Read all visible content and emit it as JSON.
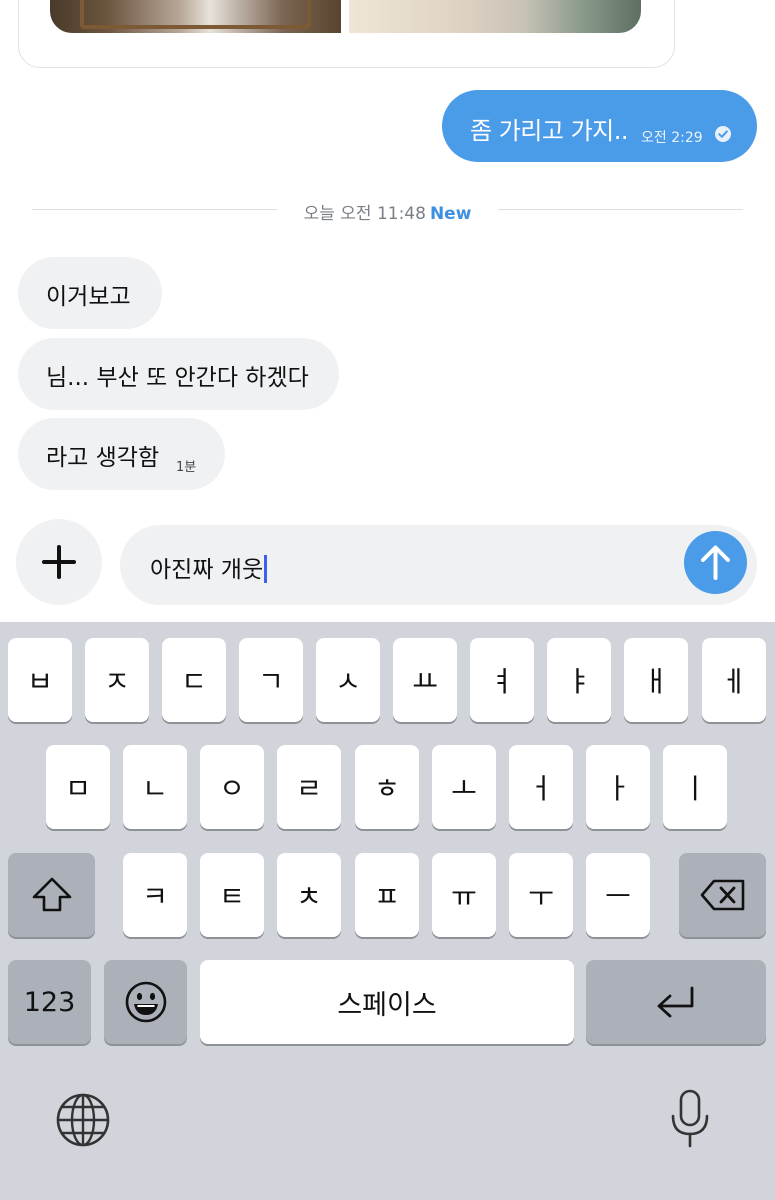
{
  "sent_message": {
    "text": "좀 가리고 가지..",
    "time": "오전 2:29"
  },
  "divider": {
    "label": "오늘 오전 11:48",
    "new_badge": "New"
  },
  "received_messages": [
    {
      "text": "이거보고"
    },
    {
      "text": "님... 부산 또 안간다 하겠다"
    },
    {
      "text": "라고 생각함",
      "time": "1분"
    }
  ],
  "composer": {
    "input_value": "아진짜 개웃"
  },
  "keyboard": {
    "row1": [
      "ㅂ",
      "ㅈ",
      "ㄷ",
      "ㄱ",
      "ㅅ",
      "ㅛ",
      "ㅕ",
      "ㅑ",
      "ㅐ",
      "ㅔ"
    ],
    "row2": [
      "ㅁ",
      "ㄴ",
      "ㅇ",
      "ㄹ",
      "ㅎ",
      "ㅗ",
      "ㅓ",
      "ㅏ",
      "ㅣ"
    ],
    "row3": [
      "ㅋ",
      "ㅌ",
      "ㅊ",
      "ㅍ",
      "ㅠ",
      "ㅜ",
      "ㅡ"
    ],
    "numbers_label": "123",
    "space_label": "스페이스"
  },
  "colors": {
    "accent": "#4a9be8",
    "new_badge": "#3d8fe0",
    "bubble_received": "#eff1f3",
    "keyboard_bg": "#d1d4da"
  },
  "icons": [
    "plus-icon",
    "send-arrow-icon",
    "read-check-icon",
    "shift-icon",
    "backspace-icon",
    "emoji-icon",
    "return-icon",
    "globe-icon",
    "microphone-icon"
  ]
}
